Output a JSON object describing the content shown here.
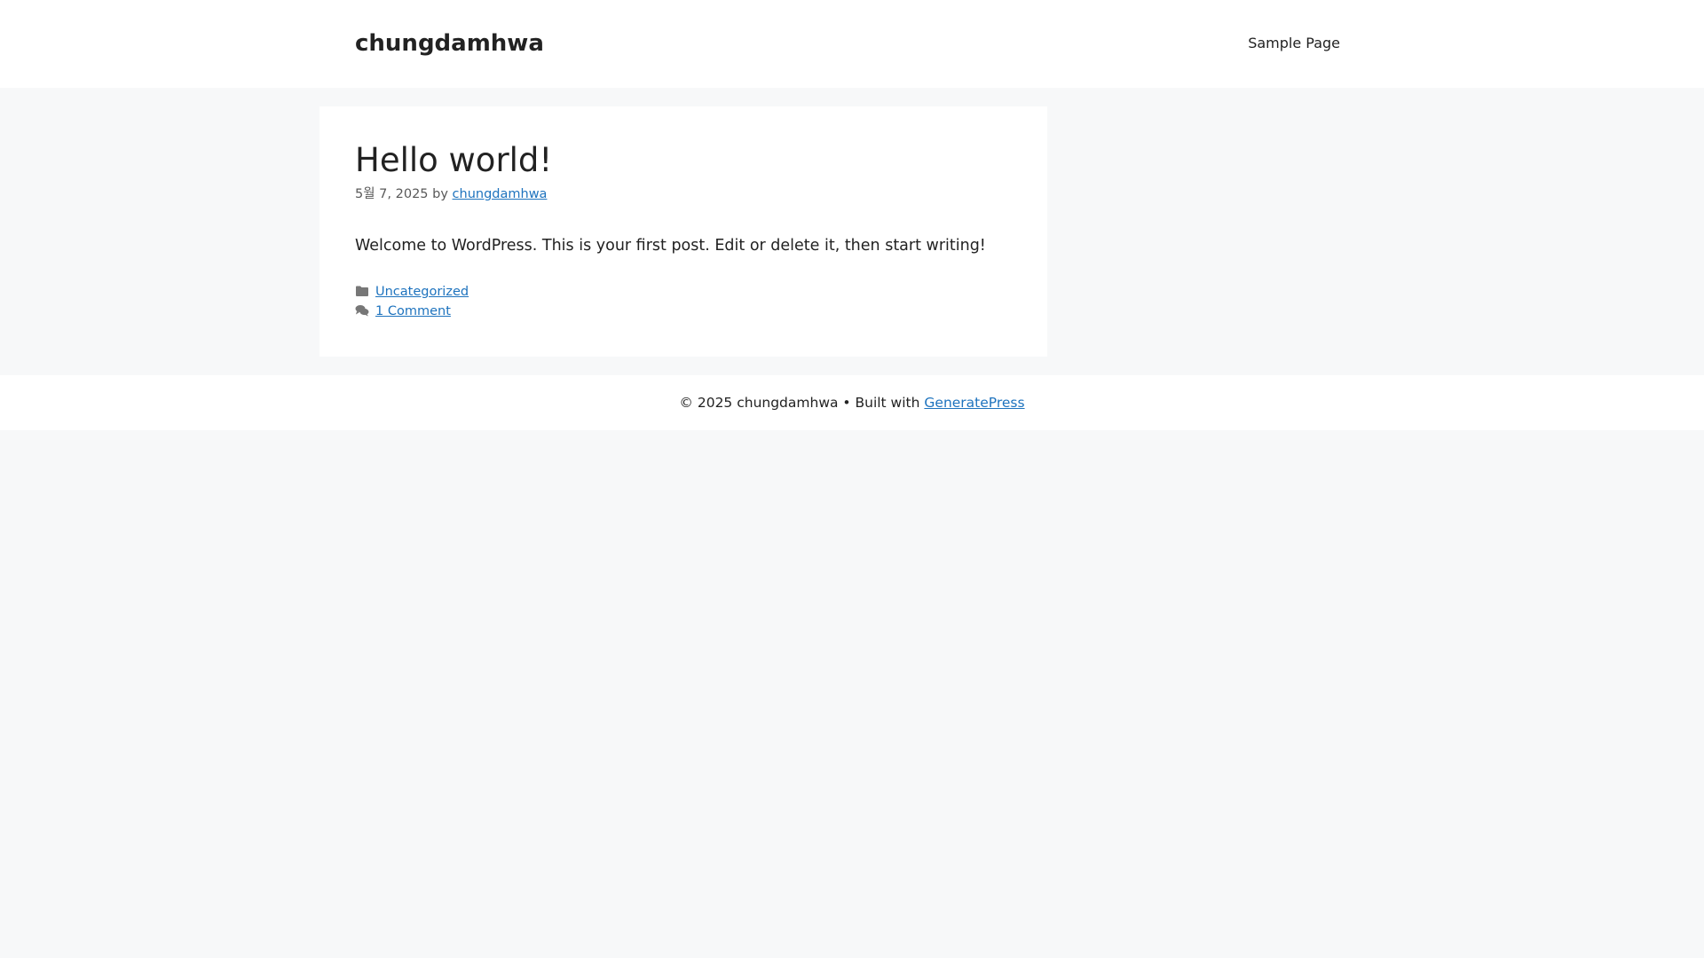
{
  "header": {
    "site_title": "chungdamhwa",
    "nav": [
      {
        "label": "Sample Page"
      }
    ]
  },
  "post": {
    "title": "Hello world!",
    "date": "5월 7, 2025",
    "by_label": "by",
    "author": "chungdamhwa",
    "content": "Welcome to WordPress. This is your first post. Edit or delete it, then start writing!",
    "category": "Uncategorized",
    "comments": "1 Comment",
    "icons": {
      "category": "folder-icon",
      "comments": "comments-icon"
    }
  },
  "footer": {
    "copyright_prefix": "© 2025 chungdamhwa • Built with",
    "theme_link": "GeneratePress"
  },
  "colors": {
    "background": "#f7f8f9",
    "surface": "#ffffff",
    "text": "#222222",
    "meta_text": "#595959",
    "link": "#1e73be",
    "icon": "#777777"
  }
}
